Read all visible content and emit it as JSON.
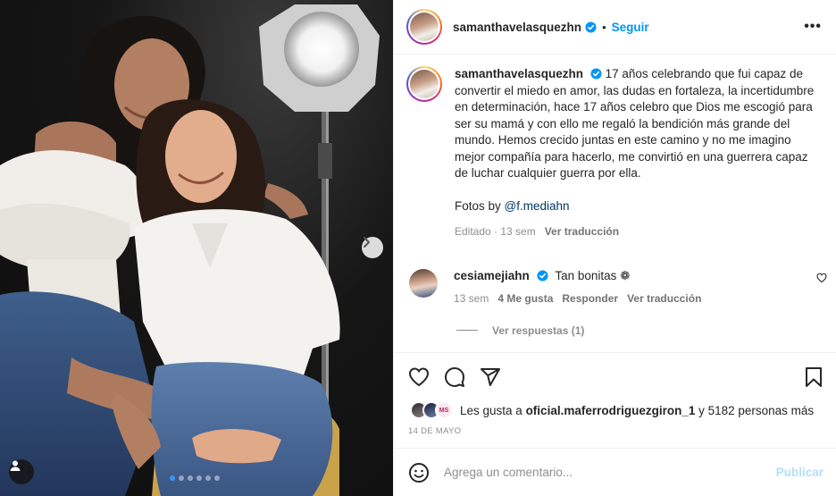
{
  "post": {
    "username": "samanthavelasquezhn",
    "follow_label": "Seguir",
    "separator": "•",
    "more_label": "•••",
    "caption": "17 años celebrando que fui capaz de convertir el miedo en amor, las dudas en fortaleza, la incertidumbre en determinación, hace 17 años celebro que Dios me escogió para ser su mamá y con ello me regaló la bendición más grande del mundo. Hemos crecido juntas en este camino y no me imagino mejor compañía para hacerlo, me convirtió en una guerrera capaz de luchar cualquier guerra por ella.",
    "photos_prefix": "Fotos by ",
    "photos_mention": "@f.mediahn",
    "edited_label": "Editado · 13 sem",
    "translate_label": "Ver traducción",
    "carousel_count": 6,
    "carousel_active": 0
  },
  "comment": {
    "username": "cesiamejiahn",
    "text": "Tan bonitas ❁",
    "time": "13 sem",
    "likes_label": "4 Me gusta",
    "reply_label": "Responder",
    "translate_label": "Ver traducción",
    "view_replies_label": "Ver respuestas (1)"
  },
  "likes": {
    "prefix": "Les gusta a ",
    "user": "oficial.maferrodriguezgiron_1",
    "suffix": " y 5182 personas más",
    "avatar_badge": "MS"
  },
  "date": "14 DE MAYO",
  "add_comment": {
    "placeholder": "Agrega un comentario...",
    "publish_label": "Publicar"
  },
  "colors": {
    "link_blue": "#0095f6",
    "mention": "#00376b",
    "muted": "#8e8e8e",
    "publish_disabled": "#b2dffc",
    "verified": "#0095f6"
  },
  "icons": [
    "verified-badge-icon",
    "more-options-icon",
    "heart-icon",
    "comment-icon",
    "share-icon",
    "bookmark-icon",
    "emoji-icon",
    "chevron-right-icon",
    "user-tag-icon"
  ]
}
